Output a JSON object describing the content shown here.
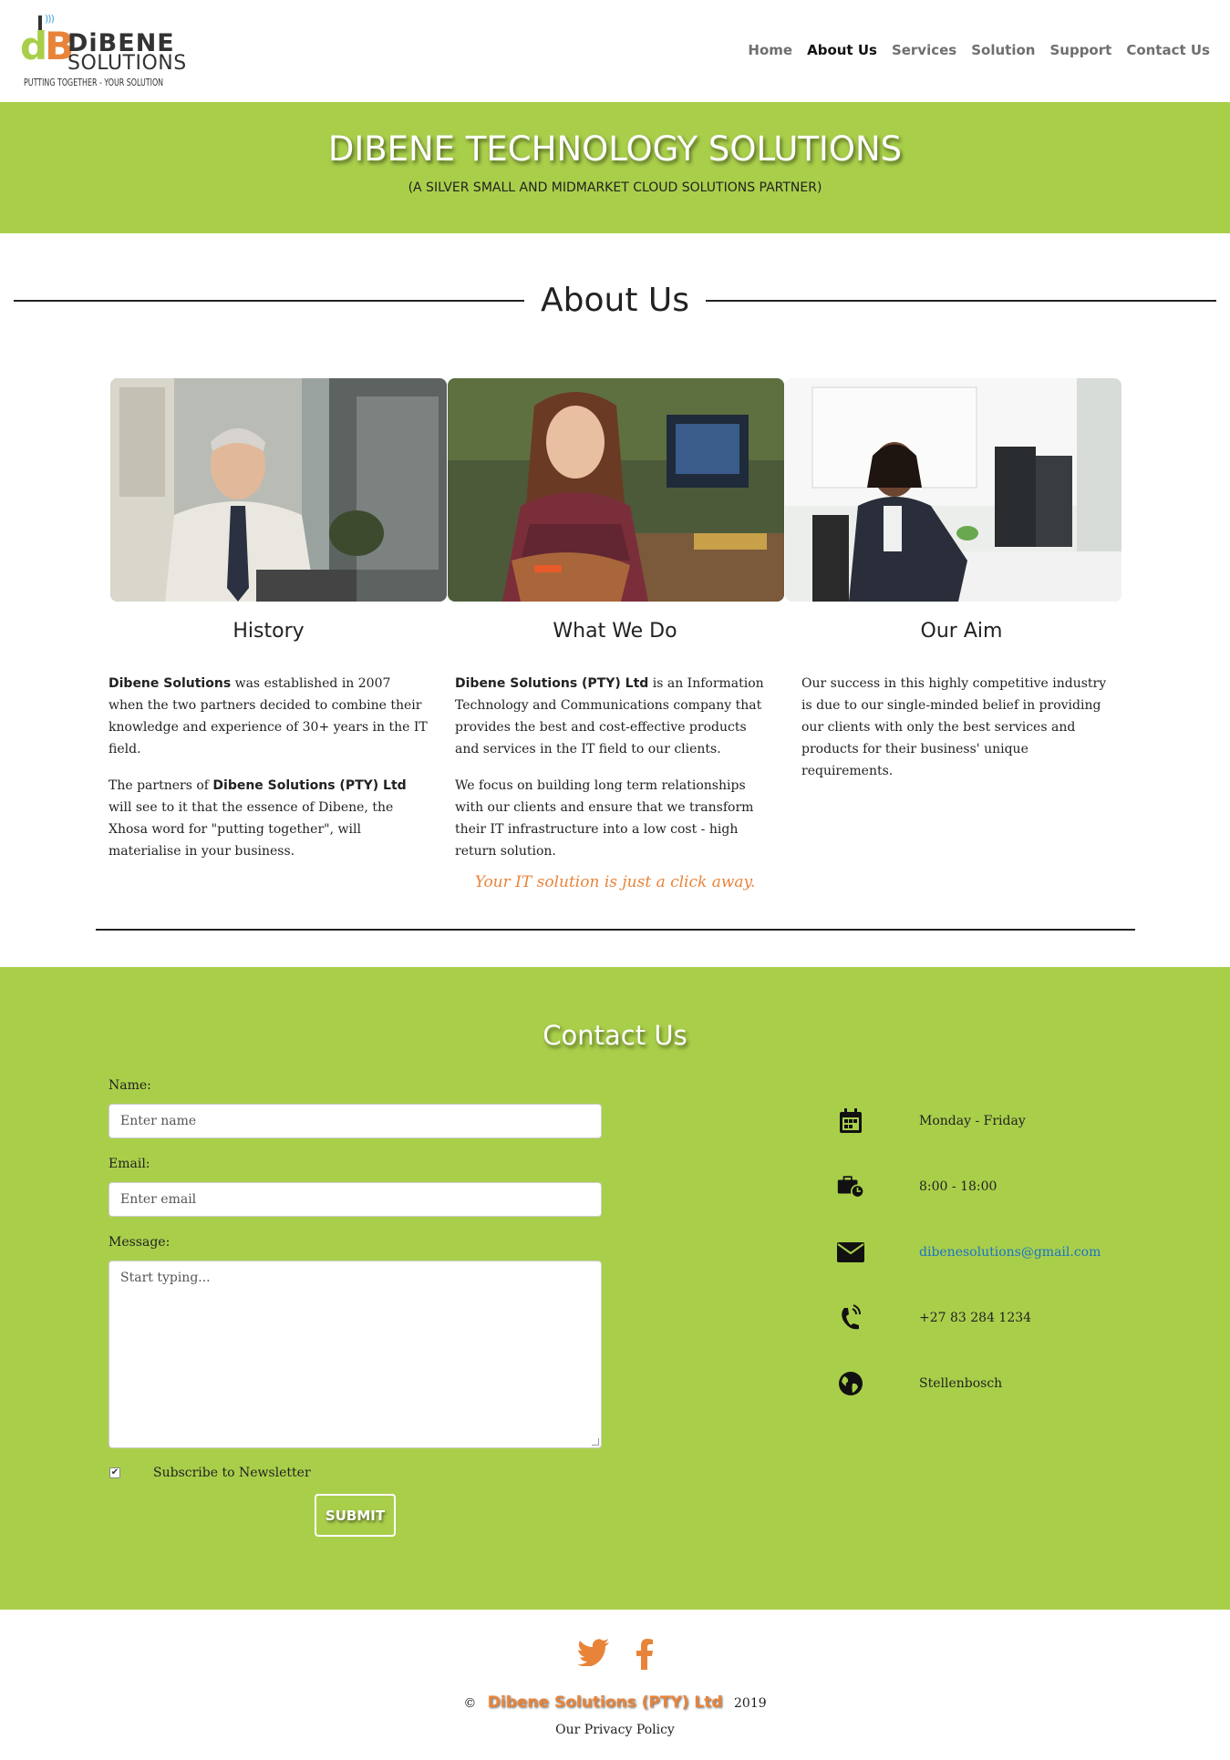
{
  "brand": {
    "logo_mark_d": "d",
    "logo_mark_b": "B",
    "name_line1": "DiBENE",
    "name_line2": "SOLUTIONS",
    "tagline": "PUTTING TOGETHER - YOUR SOLUTION",
    "colors": {
      "green": "#a9cf4a",
      "orange": "#e8843a",
      "dark": "#333333",
      "wifi": "#3aa6d8"
    }
  },
  "nav": {
    "items": [
      {
        "label": "Home",
        "active": false
      },
      {
        "label": "About Us",
        "active": true
      },
      {
        "label": "Services",
        "active": false
      },
      {
        "label": "Solution",
        "active": false
      },
      {
        "label": "Support",
        "active": false
      },
      {
        "label": "Contact Us",
        "active": false
      }
    ]
  },
  "hero": {
    "title": "DIBENE TECHNOLOGY SOLUTIONS",
    "subtitle": "(A SILVER SMALL AND MIDMARKET CLOUD SOLUTIONS PARTNER)"
  },
  "about": {
    "heading": "About Us",
    "cards": [
      {
        "title": "History",
        "image": "photo of older man in shirt and tie at desk",
        "paragraphs": [
          {
            "bold": "Dibene Solutions",
            "text": " was established in 2007 when the two partners decided to combine their knowledge and experience of 30+ years in the IT field."
          },
          {
            "pre": "The partners of ",
            "bold": "Dibene Solutions (PTY) Ltd",
            "text": " will see to it that the essence of Dibene, the Xhosa word for \"putting together\", will materialise in your business."
          }
        ]
      },
      {
        "title": "What We Do",
        "image": "photo of smiling woman in plaid shirt in office",
        "paragraphs": [
          {
            "bold": "Dibene Solutions (PTY) Ltd",
            "text": " is an Information Technology and Communications company that provides the best and cost-effective products and services in the IT field to our clients."
          },
          {
            "text": "We focus on building long term relationships with our clients and ensure that we transform their IT infrastructure into a low cost - high return solution."
          }
        ]
      },
      {
        "title": "Our Aim",
        "image": "photo of woman at computer desk in bright office",
        "paragraphs": [
          {
            "text": "Our success in this highly competitive industry is due to our single-minded belief in providing our clients with only the best services and products for their business' unique requirements."
          }
        ]
      }
    ],
    "tagline": "Your IT solution is just a click away."
  },
  "contact": {
    "heading": "Contact Us",
    "form": {
      "name_label": "Name:",
      "name_placeholder": "Enter name",
      "email_label": "Email:",
      "email_placeholder": "Enter email",
      "message_label": "Message:",
      "message_placeholder": "Start typing...",
      "subscribe_label": "Subscribe to Newsletter",
      "subscribe_checked": true,
      "submit_label": "SUBMIT"
    },
    "info": [
      {
        "icon": "calendar-icon",
        "text": "Monday - Friday"
      },
      {
        "icon": "briefcase-clock-icon",
        "text": "8:00 - 18:00"
      },
      {
        "icon": "envelope-icon",
        "text": "dibenesolutions@gmail.com"
      },
      {
        "icon": "phone-icon",
        "text": "+27 83 284 1234"
      },
      {
        "icon": "globe-icon",
        "text": "Stellenbosch"
      }
    ]
  },
  "footer": {
    "social": [
      "twitter-icon",
      "facebook-icon"
    ],
    "copyright_symbol": "©",
    "company": "Dibene Solutions (PTY) Ltd",
    "year": "2019",
    "privacy": "Our Privacy Policy"
  }
}
